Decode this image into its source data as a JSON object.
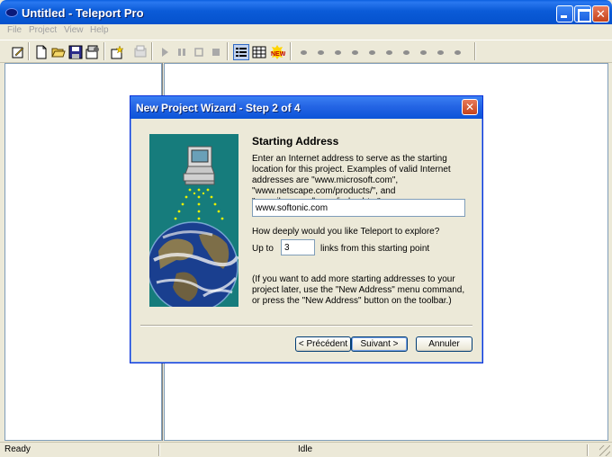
{
  "window": {
    "title": "Untitled - Teleport Pro",
    "controls": {
      "minimize": "minimize",
      "maximize": "maximize",
      "close": "✕"
    }
  },
  "menu": [
    "File",
    "Project",
    "View",
    "Help"
  ],
  "statusbar": {
    "left": "Ready",
    "center": "Idle"
  },
  "dialog": {
    "title": "New Project Wizard - Step 2 of 4",
    "close": "✕",
    "heading": "Starting Address",
    "description": "Enter an Internet address to serve as the starting location for this project.  Examples of valid Internet addresses are \"www.microsoft.com\", \"www.netscape.com/products/\", and \"www.ibm.com/home/index.htm\".",
    "address_value": "www.softonic.com",
    "depth_question": "How deeply would you like Teleport to explore?",
    "up_to_label": "Up to",
    "depth_value": "3",
    "links_label": "links from this starting point",
    "note": "(If you want to add more starting addresses to your project later, use the \"New Address\" menu command, or press the \"New Address\" button on the toolbar.)",
    "buttons": {
      "back": "< Précédent",
      "next": "Suivant >",
      "cancel": "Annuler"
    }
  },
  "icons": {
    "toolbar": [
      "edit-icon",
      "new-file-icon",
      "open-folder-icon",
      "save-icon",
      "properties-icon",
      "new-address-icon",
      "print-icon",
      "play-icon",
      "pause-icon",
      "stop-square-icon",
      "stop-icon",
      "list-view-icon",
      "grid-view-icon",
      "new-badge-icon"
    ]
  }
}
